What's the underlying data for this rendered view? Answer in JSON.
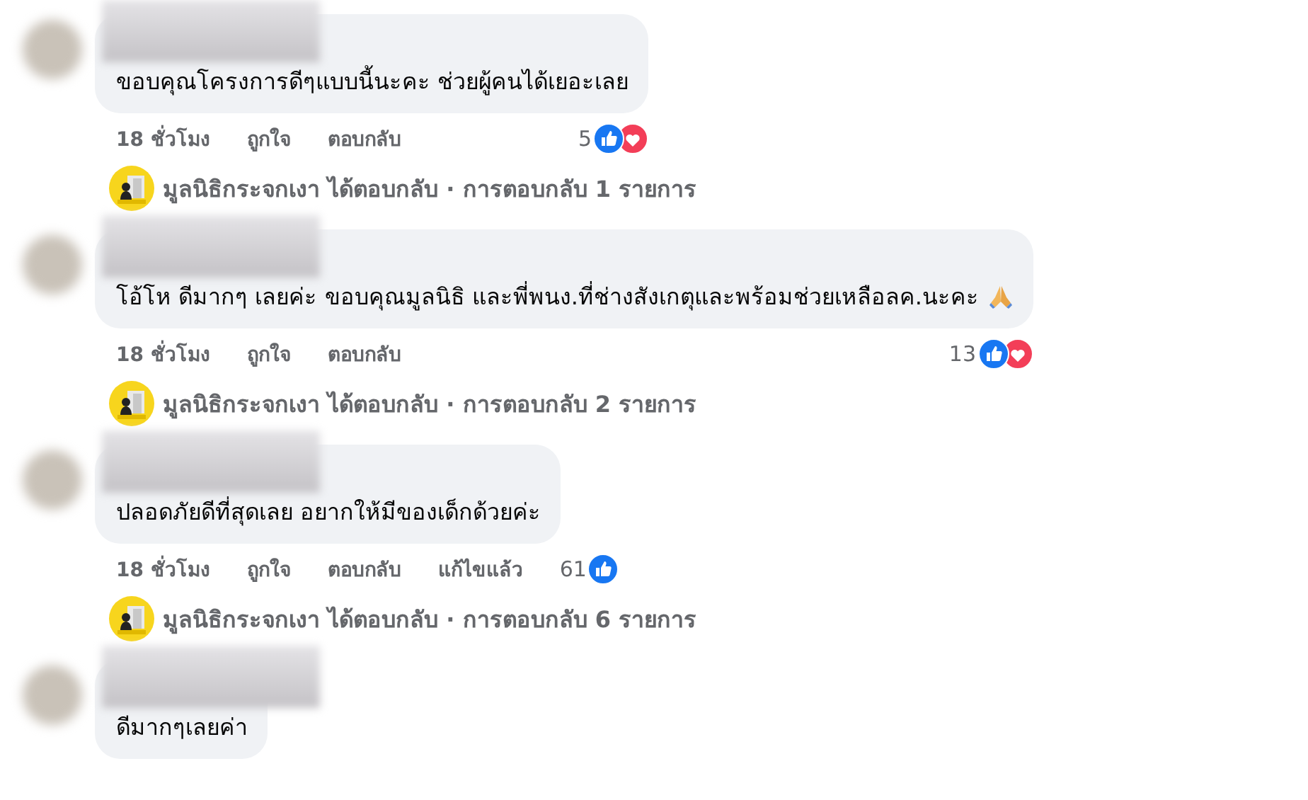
{
  "comments": [
    {
      "text": "ขอบคุณโครงการดีๆแบบนี้นะคะ ช่วยผู้คนได้เยอะเลย",
      "time": "18 ชั่วโมง",
      "like": "ถูกใจ",
      "reply": "ตอบกลับ",
      "reactions": {
        "count": "5",
        "icons": [
          {
            "kind": "like"
          },
          {
            "kind": "love"
          }
        ]
      },
      "replies": "มูลนิธิกระจกเงา ได้ตอบกลับ · การตอบกลับ 1 รายการ"
    },
    {
      "text": "โอ้โห ดีมากๆ เลยค่ะ ขอบคุณมูลนิธิ และพี่พนง.ที่ช่างสังเกตุและพร้อมช่วยเหลือลค.นะคะ",
      "emoji": {
        "kind": "pray"
      },
      "time": "18 ชั่วโมง",
      "like": "ถูกใจ",
      "reply": "ตอบกลับ",
      "reactions": {
        "count": "13",
        "icons": [
          {
            "kind": "like"
          },
          {
            "kind": "love"
          }
        ]
      },
      "replies": "มูลนิธิกระจกเงา ได้ตอบกลับ · การตอบกลับ 2 รายการ"
    },
    {
      "text": "ปลอดภัยดีที่สุดเลย อยากให้มีของเด็กด้วยค่ะ",
      "time": "18 ชั่วโมง",
      "like": "ถูกใจ",
      "reply": "ตอบกลับ",
      "edited": "แก้ไขแล้ว",
      "reactions": {
        "count": "61",
        "icons": [
          {
            "kind": "like"
          }
        ]
      },
      "replies": "มูลนิธิกระจกเงา ได้ตอบกลับ · การตอบกลับ 6 รายการ"
    },
    {
      "text": "ดีมากๆเลยค่า"
    }
  ]
}
